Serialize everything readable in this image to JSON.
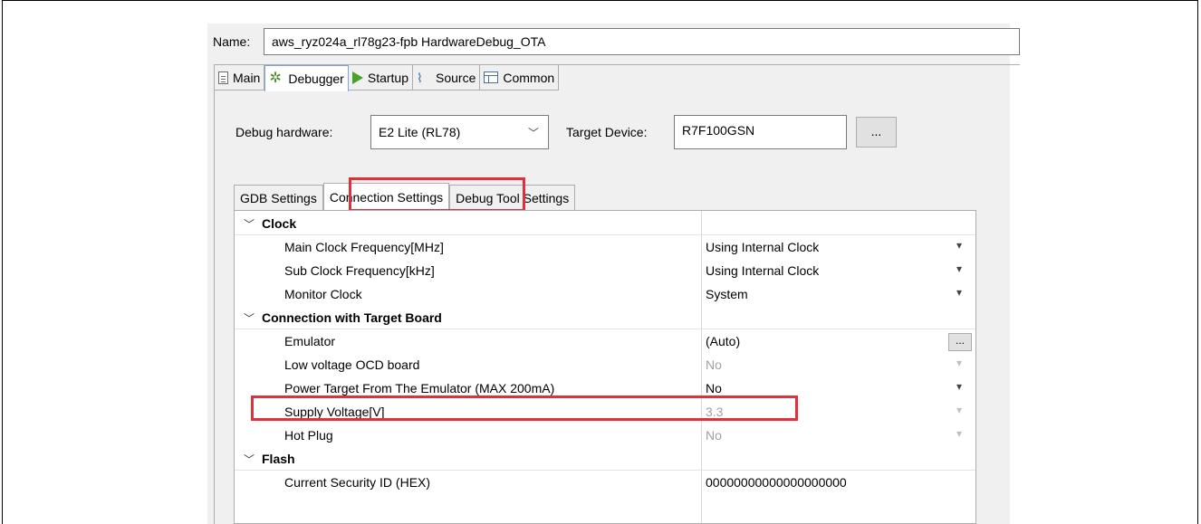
{
  "config": {
    "name_label": "Name:",
    "name_value": "aws_ryz024a_rl78g23-fpb HardwareDebug_OTA"
  },
  "main_tabs": [
    {
      "label": "Main",
      "icon": "document-icon",
      "active": false
    },
    {
      "label": "Debugger",
      "icon": "bug-icon",
      "active": true
    },
    {
      "label": "Startup",
      "icon": "play-icon",
      "active": false
    },
    {
      "label": "Source",
      "icon": "source-icon",
      "active": false
    },
    {
      "label": "Common",
      "icon": "common-icon",
      "active": false
    }
  ],
  "debugger": {
    "hardware_label": "Debug hardware:",
    "hardware_value": "E2 Lite (RL78)",
    "target_label": "Target Device:",
    "target_value": "R7F100GSN",
    "browse_label": "..."
  },
  "sub_tabs": [
    {
      "label": "GDB Settings",
      "active": false
    },
    {
      "label": "Connection Settings",
      "active": true
    },
    {
      "label": "Debug Tool Settings",
      "active": false
    }
  ],
  "properties": {
    "clock": {
      "label": "Clock",
      "rows": [
        {
          "name": "Main Clock Frequency[MHz]",
          "value": "Using Internal Clock"
        },
        {
          "name": "Sub Clock Frequency[kHz]",
          "value": "Using Internal Clock"
        },
        {
          "name": "Monitor Clock",
          "value": "System"
        }
      ]
    },
    "connection": {
      "label": "Connection with Target Board",
      "rows": [
        {
          "name": "Emulator",
          "value": "(Auto)"
        },
        {
          "name": "Low voltage OCD board",
          "value": "No"
        },
        {
          "name": "Power Target From The Emulator (MAX 200mA)",
          "value": "No"
        },
        {
          "name": "Supply Voltage[V]",
          "value": "3.3"
        },
        {
          "name": "Hot Plug",
          "value": "No"
        }
      ]
    },
    "flash": {
      "label": "Flash",
      "rows": [
        {
          "name": "Current Security ID (HEX)",
          "value": "00000000000000000000"
        }
      ]
    }
  },
  "colors": {
    "highlight": "#e0303a",
    "panel_bg": "#f0f0f0"
  }
}
